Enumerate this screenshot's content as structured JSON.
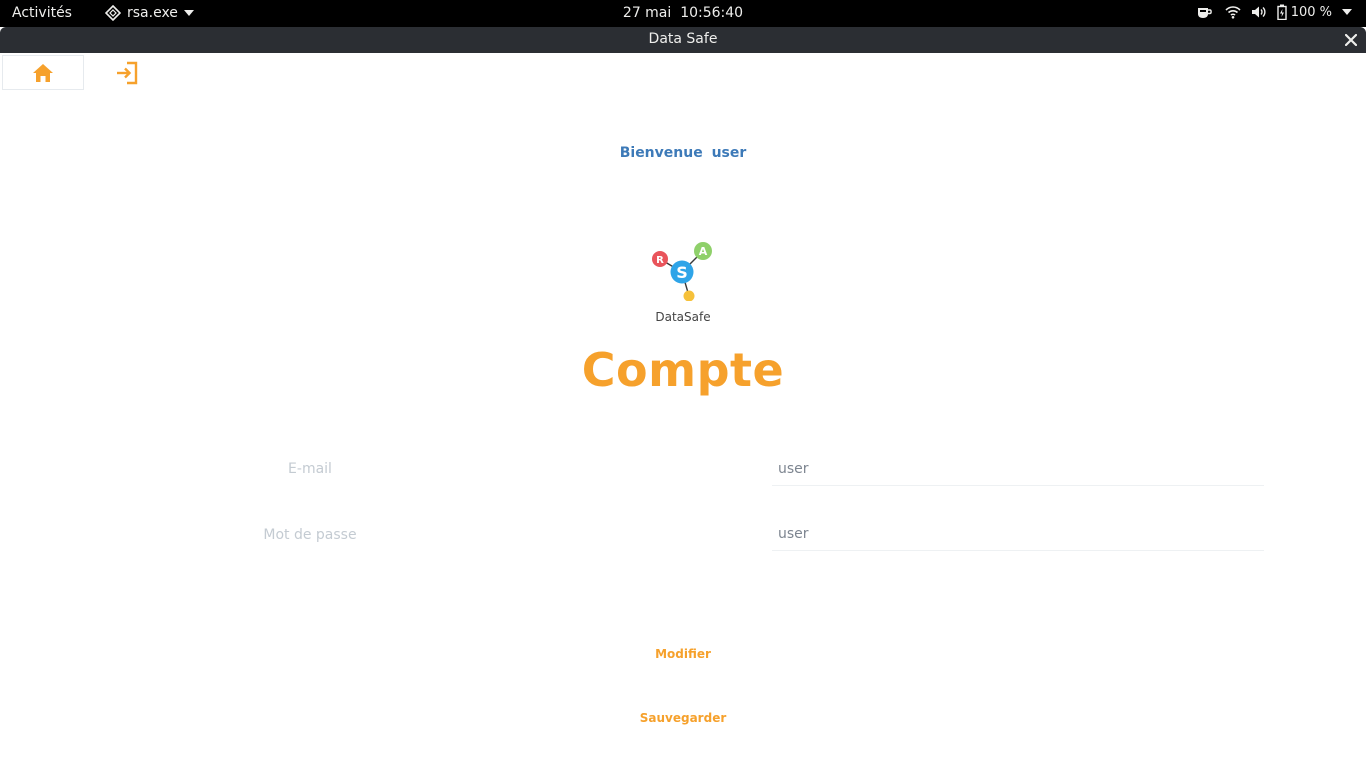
{
  "system_bar": {
    "activities": "Activités",
    "app_name": "rsa.exe",
    "date": "27 mai",
    "time": "10:56:40",
    "battery": "100 %"
  },
  "window": {
    "title": "Data Safe"
  },
  "nav": {
    "home_icon": "home-icon",
    "logout_icon": "logout-icon"
  },
  "welcome": {
    "greeting": "Bienvenue",
    "username": "user"
  },
  "logo": {
    "label": "DataSafe",
    "letters": [
      "R",
      "S",
      "A"
    ]
  },
  "page": {
    "title": "Compte"
  },
  "form": {
    "email_label": "E-mail",
    "email_value": "user",
    "password_label": "Mot de passe",
    "password_value": "user"
  },
  "actions": {
    "modify": "Modifier",
    "save": "Sauvegarder"
  },
  "colors": {
    "accent": "#f6a12c",
    "welcome_text": "#3d7ab8",
    "label_text": "#c4cbd2"
  }
}
